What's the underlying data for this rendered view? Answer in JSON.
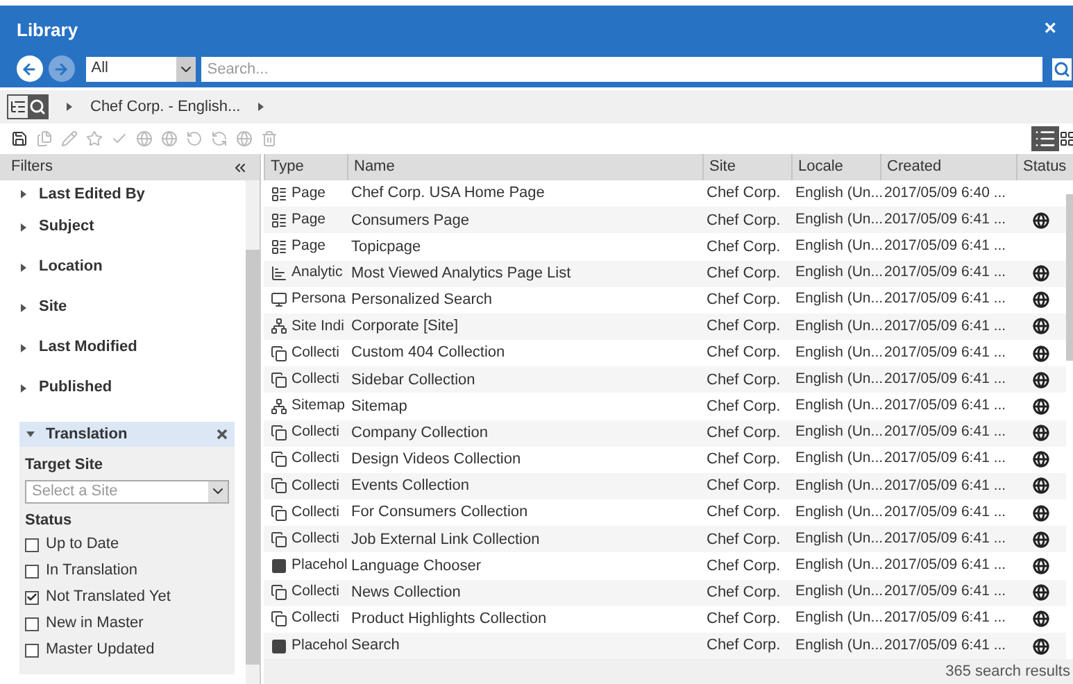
{
  "window": {
    "title": "Library",
    "close": "×"
  },
  "search": {
    "scope": "All",
    "placeholder": "Search..."
  },
  "breadcrumb": [
    "Chef Corp. - English..."
  ],
  "filters": {
    "title": "Filters",
    "items": [
      {
        "label": "Last Edited By",
        "expanded": false
      },
      {
        "label": "Subject",
        "expanded": false
      },
      {
        "label": "Location",
        "expanded": false
      },
      {
        "label": "Site",
        "expanded": false
      },
      {
        "label": "Last Modified",
        "expanded": false
      },
      {
        "label": "Published",
        "expanded": false
      },
      {
        "label": "Translation",
        "expanded": true,
        "target_label": "Target Site",
        "target_placeholder": "Select a Site",
        "status_label": "Status",
        "options": [
          {
            "label": "Up to Date",
            "checked": false
          },
          {
            "label": "In Translation",
            "checked": false
          },
          {
            "label": "Not Translated Yet",
            "checked": true
          },
          {
            "label": "New in Master",
            "checked": false
          },
          {
            "label": "Master Updated",
            "checked": false
          }
        ]
      }
    ]
  },
  "table": {
    "columns": [
      "Type",
      "Name",
      "Site",
      "Locale",
      "Created",
      "Status"
    ],
    "rows": [
      {
        "kind": "page",
        "type": "Page",
        "name": "Chef Corp. USA Home Page",
        "site": "Chef Corp.",
        "locale": "English (Un...",
        "created": "2017/05/09 6:40 ...",
        "published": false
      },
      {
        "kind": "page",
        "type": "Page",
        "name": "Consumers Page",
        "site": "Chef Corp.",
        "locale": "English (Un...",
        "created": "2017/05/09 6:41 ...",
        "published": true
      },
      {
        "kind": "page",
        "type": "Page",
        "name": "Topicpage",
        "site": "Chef Corp.",
        "locale": "English (Un...",
        "created": "2017/05/09 6:41 ...",
        "published": false
      },
      {
        "kind": "analytics",
        "type": "Analytic",
        "name": "Most Viewed Analytics Page List",
        "site": "Chef Corp.",
        "locale": "English (Un...",
        "created": "2017/05/09 6:41 ...",
        "published": true
      },
      {
        "kind": "personalization",
        "type": "Persona",
        "name": "Personalized Search",
        "site": "Chef Corp.",
        "locale": "English (Un...",
        "created": "2017/05/09 6:41 ...",
        "published": true
      },
      {
        "kind": "site",
        "type": "Site Indi",
        "name": "Corporate [Site]",
        "site": "Chef Corp.",
        "locale": "English (Un...",
        "created": "2017/05/09 6:41 ...",
        "published": true
      },
      {
        "kind": "collection",
        "type": "Collecti",
        "name": "Custom 404 Collection",
        "site": "Chef Corp.",
        "locale": "English (Un...",
        "created": "2017/05/09 6:41 ...",
        "published": true
      },
      {
        "kind": "collection",
        "type": "Collecti",
        "name": "Sidebar Collection",
        "site": "Chef Corp.",
        "locale": "English (Un...",
        "created": "2017/05/09 6:41 ...",
        "published": true
      },
      {
        "kind": "site",
        "type": "Sitemap",
        "name": "Sitemap",
        "site": "Chef Corp.",
        "locale": "English (Un...",
        "created": "2017/05/09 6:41 ...",
        "published": true
      },
      {
        "kind": "collection",
        "type": "Collecti",
        "name": "Company Collection",
        "site": "Chef Corp.",
        "locale": "English (Un...",
        "created": "2017/05/09 6:41 ...",
        "published": true
      },
      {
        "kind": "collection",
        "type": "Collecti",
        "name": "Design Videos Collection",
        "site": "Chef Corp.",
        "locale": "English (Un...",
        "created": "2017/05/09 6:41 ...",
        "published": true
      },
      {
        "kind": "collection",
        "type": "Collecti",
        "name": "Events Collection",
        "site": "Chef Corp.",
        "locale": "English (Un...",
        "created": "2017/05/09 6:41 ...",
        "published": true
      },
      {
        "kind": "collection",
        "type": "Collecti",
        "name": "For Consumers Collection",
        "site": "Chef Corp.",
        "locale": "English (Un...",
        "created": "2017/05/09 6:41 ...",
        "published": true
      },
      {
        "kind": "collection",
        "type": "Collecti",
        "name": "Job External Link Collection",
        "site": "Chef Corp.",
        "locale": "English (Un...",
        "created": "2017/05/09 6:41 ...",
        "published": true
      },
      {
        "kind": "placeholder",
        "type": "Placehol",
        "name": "Language Chooser",
        "site": "Chef Corp.",
        "locale": "English (Un...",
        "created": "2017/05/09 6:41 ...",
        "published": true
      },
      {
        "kind": "collection",
        "type": "Collecti",
        "name": "News Collection",
        "site": "Chef Corp.",
        "locale": "English (Un...",
        "created": "2017/05/09 6:41 ...",
        "published": true
      },
      {
        "kind": "collection",
        "type": "Collecti",
        "name": "Product Highlights Collection",
        "site": "Chef Corp.",
        "locale": "English (Un...",
        "created": "2017/05/09 6:41 ...",
        "published": true
      },
      {
        "kind": "placeholder",
        "type": "Placehol",
        "name": "Search",
        "site": "Chef Corp.",
        "locale": "English (Un...",
        "created": "2017/05/09 6:41 ...",
        "published": true
      }
    ]
  },
  "status_bar": "365 search results"
}
